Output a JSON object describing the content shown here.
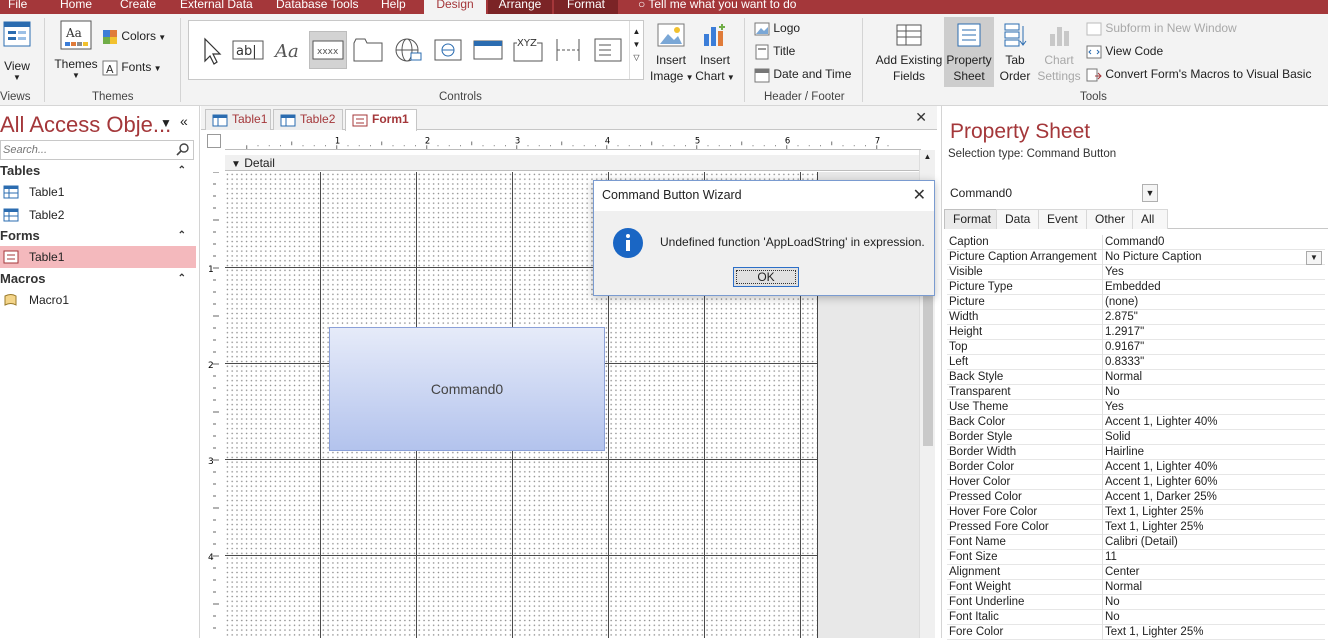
{
  "ribbon": {
    "tabs": [
      "File",
      "Home",
      "Create",
      "External Data",
      "Database Tools",
      "Help",
      "Design",
      "Arrange",
      "Format"
    ],
    "active_tab": "Design",
    "tell_me": "Tell me what you want to do",
    "groups": {
      "views": "Views",
      "themes": "Themes",
      "controls": "Controls",
      "header_footer": "Header / Footer",
      "tools": "Tools"
    },
    "view_label": "View",
    "themes_label": "Themes",
    "colors_label": "Colors",
    "fonts_label": "Fonts",
    "gallery_text_xyz": "XYZ",
    "gallery_text_ab": "ab|",
    "gallery_text_aa": "Aa",
    "gallery_text_xxxx": "xxxx",
    "insert_image_1": "Insert",
    "insert_image_2": "Image",
    "insert_chart_1": "Insert",
    "insert_chart_2": "Chart",
    "logo": "Logo",
    "title": "Title",
    "date_time": "Date and Time",
    "add_fields_1": "Add Existing",
    "add_fields_2": "Fields",
    "property_1": "Property",
    "property_2": "Sheet",
    "tab_order_1": "Tab",
    "tab_order_2": "Order",
    "chart_settings_1": "Chart",
    "chart_settings_2": "Settings",
    "subform_new": "Subform in New Window",
    "view_code": "View Code",
    "convert_macros": "Convert Form's Macros to Visual Basic"
  },
  "nav": {
    "title": "All Access Obje...",
    "search_placeholder": "Search...",
    "sections": [
      {
        "header": "Tables",
        "items": [
          "Table1",
          "Table2"
        ]
      },
      {
        "header": "Forms",
        "items": [
          "Table1"
        ]
      },
      {
        "header": "Macros",
        "items": [
          "Macro1"
        ]
      }
    ]
  },
  "doc": {
    "tabs": [
      "Table1",
      "Table2",
      "Form1"
    ],
    "active_tab": "Form1",
    "ruler_marks": [
      "1",
      "2",
      "3",
      "4",
      "5",
      "6",
      "7"
    ],
    "vruler_marks": [
      "1",
      "2",
      "3",
      "4"
    ],
    "section_label": "Detail",
    "command_button": "Command0"
  },
  "dialog": {
    "title": "Command Button Wizard",
    "message": "Undefined function 'AppLoadString' in expression.",
    "ok": "OK"
  },
  "property_sheet": {
    "title": "Property Sheet",
    "selection_type": "Selection type:  Command Button",
    "selected_object": "Command0",
    "tabs": [
      "Format",
      "Data",
      "Event",
      "Other",
      "All"
    ],
    "active_tab": "Format",
    "rows": [
      [
        "Caption",
        "Command0"
      ],
      [
        "Picture Caption Arrangement",
        "No Picture Caption"
      ],
      [
        "Visible",
        "Yes"
      ],
      [
        "Picture Type",
        "Embedded"
      ],
      [
        "Picture",
        "(none)"
      ],
      [
        "Width",
        "2.875\""
      ],
      [
        "Height",
        "1.2917\""
      ],
      [
        "Top",
        "0.9167\""
      ],
      [
        "Left",
        "0.8333\""
      ],
      [
        "Back Style",
        "Normal"
      ],
      [
        "Transparent",
        "No"
      ],
      [
        "Use Theme",
        "Yes"
      ],
      [
        "Back Color",
        "Accent 1, Lighter 40%"
      ],
      [
        "Border Style",
        "Solid"
      ],
      [
        "Border Width",
        "Hairline"
      ],
      [
        "Border Color",
        "Accent 1, Lighter 40%"
      ],
      [
        "Hover Color",
        "Accent 1, Lighter 60%"
      ],
      [
        "Pressed Color",
        "Accent 1, Darker 25%"
      ],
      [
        "Hover Fore Color",
        "Text 1, Lighter 25%"
      ],
      [
        "Pressed Fore Color",
        "Text 1, Lighter 25%"
      ],
      [
        "Font Name",
        "Calibri (Detail)"
      ],
      [
        "Font Size",
        "11"
      ],
      [
        "Alignment",
        "Center"
      ],
      [
        "Font Weight",
        "Normal"
      ],
      [
        "Font Underline",
        "No"
      ],
      [
        "Font Italic",
        "No"
      ],
      [
        "Fore Color",
        "Text 1, Lighter 25%"
      ]
    ]
  },
  "colors": {
    "accent": "#a4373a",
    "button_top": "#e6ebf9",
    "button_bottom": "#b3c3ed",
    "info_icon": "#1a66c4"
  }
}
